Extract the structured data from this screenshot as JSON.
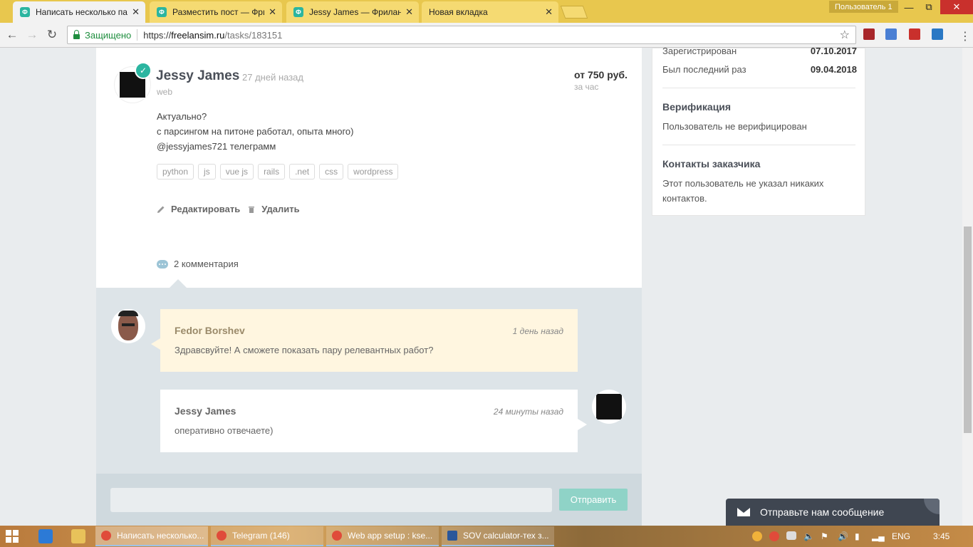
{
  "browser": {
    "tabs": [
      {
        "title": "Написать несколько пар",
        "active": true
      },
      {
        "title": "Разместить пост — Фри",
        "active": false
      },
      {
        "title": "Jessy James — Фриланс",
        "active": false
      },
      {
        "title": "Новая вкладка",
        "active": false
      }
    ],
    "tab_close": "✕",
    "fav_letter": "Ф",
    "user_badge": "Пользователь 1",
    "secure_label": "Защищено",
    "url_scheme": "https://",
    "url_host": "freelansim.ru",
    "url_path": "/tasks/183151"
  },
  "post": {
    "author": "Jessy James",
    "ago": "27 дней назад",
    "category": "web",
    "price": "от 750 руб.",
    "price_unit": "за час",
    "body": [
      "Актуально?",
      "с парсингом на питоне работал, опыта много)",
      "@jessyjames721 телеграмм"
    ],
    "tags": [
      "python",
      "js",
      "vue js",
      "rails",
      ".net",
      "css",
      "wordpress"
    ],
    "edit_label": "Редактировать",
    "delete_label": "Удалить",
    "comments_count": "2 комментария"
  },
  "comments": [
    {
      "author": "Fedor Borshev",
      "time": "1 день назад",
      "text": "Здравсвуйте! А сможете показать пару релевантных работ?"
    },
    {
      "author": "Jessy James",
      "time": "24 минуты назад",
      "text": "оперативно отвечаете)"
    }
  ],
  "reply": {
    "send_label": "Отправить"
  },
  "sidebar": {
    "registered_label": "Зарегистрирован",
    "registered_value": "07.10.2017",
    "last_seen_label": "Был последний раз",
    "last_seen_value": "09.04.2018",
    "verification_title": "Верификация",
    "verification_text": "Пользователь не верифицирован",
    "contacts_title": "Контакты заказчика",
    "contacts_text": "Этот пользователь не указал никаких контактов."
  },
  "chat_widget": {
    "label": "Отправьте нам сообщение"
  },
  "taskbar": {
    "items": [
      {
        "label": "Написать несколько...",
        "color": "#e04b3a"
      },
      {
        "label": "Telegram (146)",
        "color": "#e04b3a"
      },
      {
        "label": "Web app setup : kse...",
        "color": "#e04b3a"
      },
      {
        "label": "SOV calculator-тех з...",
        "color": "#2b579a"
      }
    ],
    "lang": "ENG",
    "clock": "3:45"
  },
  "colors": {
    "accent": "#2bb5a0",
    "chrome_frame": "#e8c74e"
  }
}
